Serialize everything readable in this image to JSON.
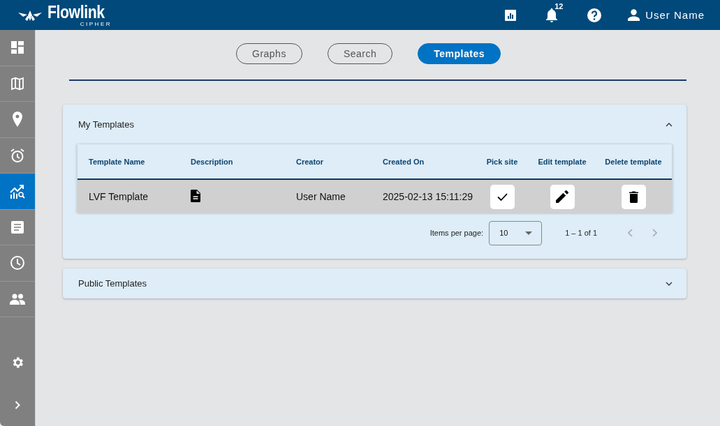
{
  "header": {
    "logo": {
      "name": "Flowlink",
      "sub": "CIPHER"
    },
    "notifications_badge": "12",
    "user": "User Name"
  },
  "sidebar": {
    "items": [
      {
        "kind": "dashboard",
        "selected": false
      },
      {
        "kind": "map",
        "selected": false
      },
      {
        "kind": "pin",
        "selected": false
      },
      {
        "kind": "alarm",
        "selected": false
      },
      {
        "kind": "analytics",
        "selected": true
      },
      {
        "kind": "notes",
        "selected": false
      },
      {
        "kind": "history",
        "selected": false
      },
      {
        "kind": "users",
        "selected": false
      }
    ]
  },
  "tabs": [
    {
      "label": "Graphs",
      "selected": false
    },
    {
      "label": "Search",
      "selected": false
    },
    {
      "label": "Templates",
      "selected": true
    }
  ],
  "panels": [
    {
      "title": "My Templates",
      "expanded": true,
      "table": {
        "columns": [
          "Template Name",
          "Description",
          "Creator",
          "Created On",
          "Pick site",
          "Edit template",
          "Delete template"
        ],
        "rows": [
          {
            "name": "LVF Template",
            "creator": "User Name",
            "created_on": "2025-02-13 15:11:29"
          }
        ]
      },
      "paginator": {
        "label": "Items per page:",
        "page_size": "10",
        "range": "1 – 1 of 1"
      }
    },
    {
      "title": "Public Templates",
      "expanded": false
    }
  ]
}
